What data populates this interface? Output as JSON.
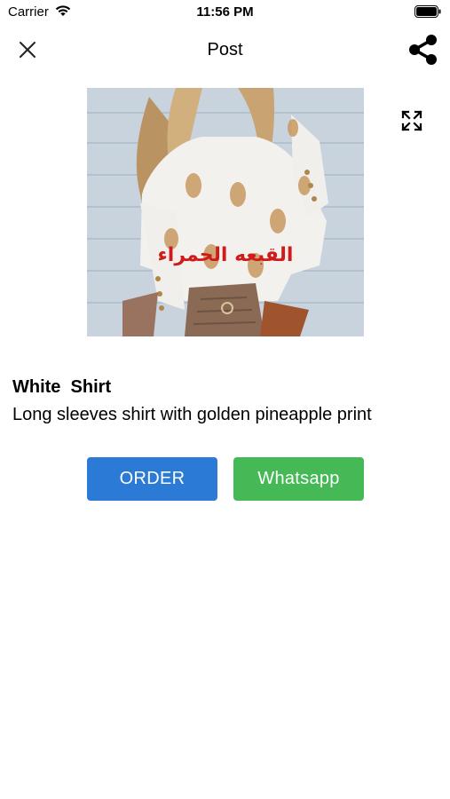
{
  "status_bar": {
    "carrier": "Carrier",
    "time": "11:56 PM",
    "wifi_icon": "wifi-icon",
    "battery_icon": "battery-icon"
  },
  "nav": {
    "title": "Post",
    "close_icon": "close-icon",
    "share_icon": "share-icon"
  },
  "product": {
    "image_overlay_text": "القبعه الحمراء",
    "expand_icon": "expand-icon",
    "name": "White  Shirt",
    "description": "Long sleeves shirt with golden pineapple print"
  },
  "actions": {
    "order_label": "ORDER",
    "whatsapp_label": "Whatsapp"
  },
  "colors": {
    "order_button": "#2a7ad6",
    "whatsapp_button": "#45b955",
    "overlay_text": "#d11a1a"
  }
}
